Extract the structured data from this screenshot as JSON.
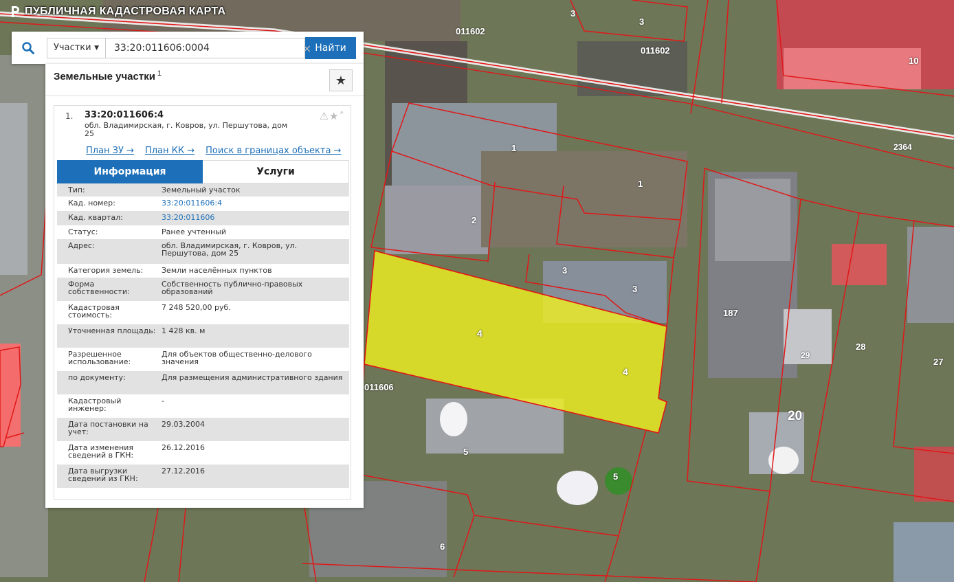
{
  "app": {
    "title": "ПУБЛИЧНАЯ КАДАСТРОВАЯ КАРТА",
    "logo_icon": "logo-icon"
  },
  "search": {
    "icon": "search-icon",
    "type_label": "Участки",
    "query": "33:20:011606:0004",
    "clear_label": "×",
    "find_label": "Найти"
  },
  "results": {
    "header": "Земельные участки",
    "count": "1",
    "favorite_label": "★",
    "item": {
      "index": "1.",
      "cadastral_id": "33:20:011606:4",
      "address": "обл. Владимирская, г. Ковров, ул. Першутова, дом 25",
      "icons": "⚠★˄",
      "links": [
        "План ЗУ →",
        "План КК →",
        "Поиск в границах объекта →"
      ],
      "tabs": [
        "Информация",
        "Услуги"
      ],
      "info": [
        {
          "label": "Тип:",
          "value": "Земельный участок"
        },
        {
          "label": "Кад. номер:",
          "value": "33:20:011606:4"
        },
        {
          "label": "Кад. квартал:",
          "value": "33:20:011606"
        },
        {
          "label": "Статус:",
          "value": "Ранее учтенный"
        },
        {
          "label": "Адрес:",
          "value": "обл. Владимирская, г. Ковров, ул. Першутова, дом 25"
        },
        {
          "label": "Категория земель:",
          "value": "Земли населённых пунктов"
        },
        {
          "label": "Форма собственности:",
          "value": "Собственность публично-правовых образований"
        },
        {
          "label": "Кадастровая стоимость:",
          "value": "7 248 520,00 руб."
        },
        {
          "label": "Уточненная площадь:",
          "value": "1 428 кв. м"
        },
        {
          "label": "Разрешенное использование:",
          "value": "Для объектов общественно-делового значения"
        },
        {
          "label": "по документу:",
          "value": "Для размещения административного здания"
        },
        {
          "label": "Кадастровый инженер:",
          "value": "-"
        },
        {
          "label": "Дата постановки на учет:",
          "value": "29.03.2004"
        },
        {
          "label": "Дата изменения сведений в ГКН:",
          "value": "26.12.2016"
        },
        {
          "label": "Дата выгрузки сведений из ГКН:",
          "value": "27.12.2016"
        }
      ]
    }
  },
  "map": {
    "labels": [
      "011602",
      "011602",
      "011606",
      "2364",
      "3",
      "3",
      "10",
      "1",
      "1",
      "2",
      "3",
      "3",
      "4",
      "4",
      "187",
      "29",
      "28",
      "27",
      "20",
      "5",
      "5",
      "6"
    ],
    "selected_fill": "#f3f31e",
    "boundary_color": "#e01818"
  }
}
